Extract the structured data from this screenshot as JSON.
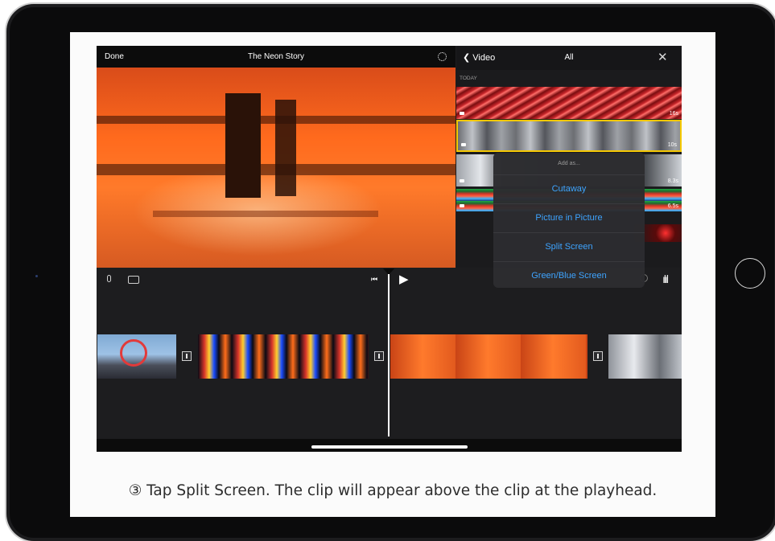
{
  "top_bar": {
    "done_label": "Done",
    "project_title": "The Neon Story"
  },
  "browser": {
    "back_label": "Video",
    "filter_label": "All",
    "section_label": "TODAY",
    "clips": [
      {
        "duration": "16s",
        "selected": false
      },
      {
        "duration": "10s",
        "selected": true
      },
      {
        "duration": "8.3s",
        "selected": false
      },
      {
        "duration": "6.5s",
        "selected": false
      }
    ]
  },
  "popover": {
    "header": "Add as...",
    "options": [
      "Cutaway",
      "Picture in Picture",
      "Split Screen",
      "Green/Blue Screen"
    ]
  },
  "caption": "③ Tap Split Screen. The clip will appear above the clip at the playhead.",
  "colors": {
    "accent_blue": "#3ea4ff",
    "selection_yellow": "#f5c800"
  }
}
